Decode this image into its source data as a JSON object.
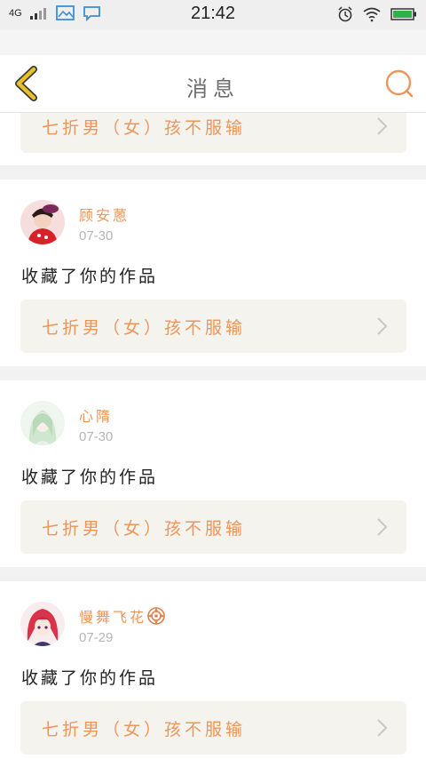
{
  "status_bar": {
    "network": "4G",
    "time": "21:42",
    "icons": [
      "signal-icon",
      "image-icon",
      "chat-icon",
      "alarm-icon",
      "wifi-icon",
      "battery-icon"
    ]
  },
  "header": {
    "title": "消息",
    "back_icon": "back-chevron-icon",
    "search_icon": "search-icon"
  },
  "messages": [
    {
      "partial": true,
      "work_title": "七折男（女）孩不服输"
    },
    {
      "user": "顾安蒽",
      "date": "07-30",
      "action": "收藏了你的作品",
      "work_title": "七折男（女）孩不服输"
    },
    {
      "user": "心隋",
      "date": "07-30",
      "action": "收藏了你的作品",
      "work_title": "七折男（女）孩不服输"
    },
    {
      "user": "慢舞飞花",
      "date": "07-29",
      "action": "收藏了你的作品",
      "work_title": "七折男（女）孩不服输",
      "badge_icon": "flower-badge-icon"
    }
  ],
  "colors": {
    "accent": "#ee955a",
    "back_icon": "#e8c12a",
    "background": "#f2f2f2",
    "card": "#ffffff",
    "link_bg": "#f4f3ee"
  }
}
